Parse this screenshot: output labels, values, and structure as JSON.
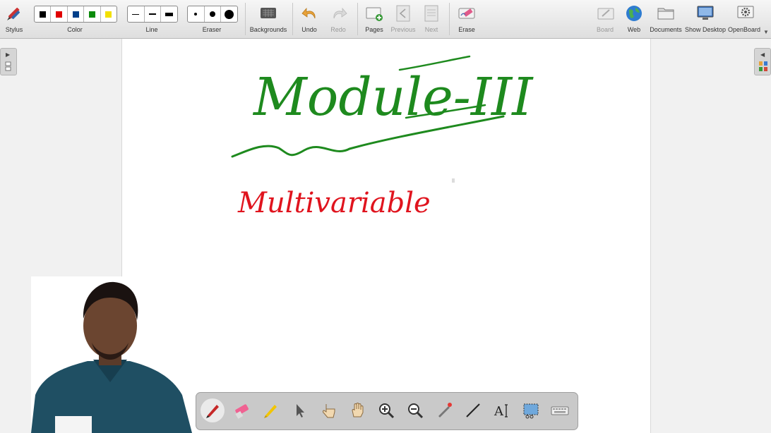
{
  "toolbar": {
    "stylus": "Stylus",
    "color": "Color",
    "line": "Line",
    "eraser": "Eraser",
    "backgrounds": "Backgrounds",
    "undo": "Undo",
    "redo": "Redo",
    "pages": "Pages",
    "previous": "Previous",
    "next": "Next",
    "erase": "Erase",
    "board": "Board",
    "web": "Web",
    "documents": "Documents",
    "show_desktop": "Show Desktop",
    "openboard": "OpenBoard"
  },
  "colors": [
    "#000000",
    "#e00000",
    "#003f8a",
    "#0a8a0a",
    "#f2e000"
  ],
  "board": {
    "heading": "Module-III",
    "subheading": "Multivariable",
    "heading_color": "#1e8a1e",
    "subheading_color": "#e0141e"
  },
  "floating_tools": [
    "pen-tool",
    "eraser-tool",
    "highlighter-tool",
    "selector-tool",
    "interact-tool",
    "hand-tool",
    "zoom-in-tool",
    "zoom-out-tool",
    "laser-pointer-tool",
    "line-tool",
    "text-tool",
    "capture-tool",
    "keyboard-tool"
  ]
}
